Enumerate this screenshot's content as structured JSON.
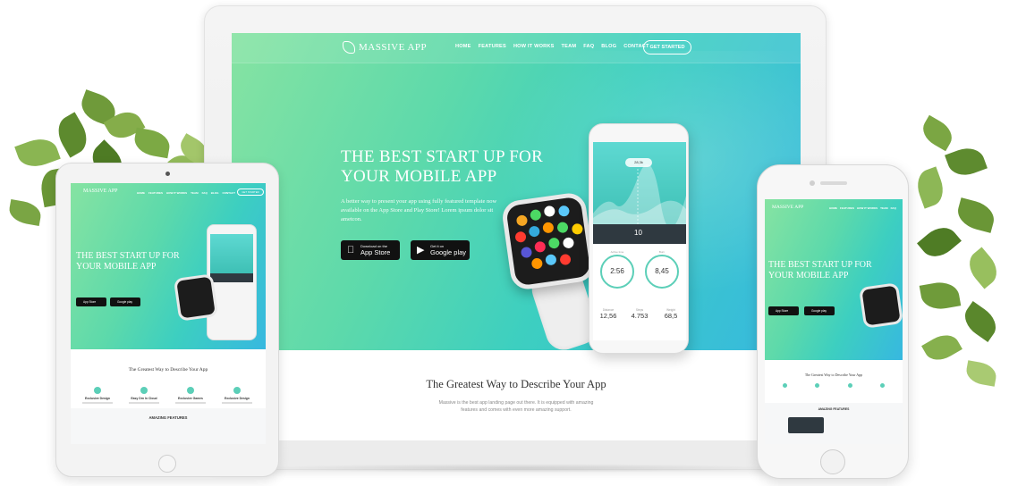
{
  "brand": {
    "name": "MASSIVE",
    "suffix": "APP"
  },
  "nav": {
    "links": [
      "HOME",
      "FEATURES",
      "HOW IT WORKS",
      "TEAM",
      "FAQ",
      "BLOG",
      "CONTACT"
    ],
    "cta": "GET STARTED"
  },
  "hero": {
    "title_line1": "THE BEST START UP FOR",
    "title_line2": "YOUR MOBILE APP",
    "text": "A better way to present your app using fully featured template now available on the App Store and Play Store! Lorem ipsum dolor sit ametcon.",
    "app_store": {
      "small": "Download on the",
      "big": "App Store"
    },
    "google_play": {
      "small": "Get it on",
      "big": "Google play"
    }
  },
  "section": {
    "title": "The Greatest Way to Describe Your App",
    "text": "Massive is the best app landing page out there. It is equipped with amazing features and comes with even more amazing support."
  },
  "tablet": {
    "section_title": "The Greatest Way to Describe Your App",
    "features": [
      "Exclusive Design",
      "Easy Drn In Cloud",
      "Exclusive Games",
      "Exclusive Design"
    ],
    "amazing": "AMAZING FEATURES"
  },
  "phone": {
    "nav_links": [
      "HOME",
      "FEATURES",
      "HOW IT WORKS",
      "TEAM",
      "FAQ"
    ],
    "section_title": "The Greatest Way to Describe Your App",
    "amazing": "AMAZING FEATURES"
  },
  "app_ui": {
    "badge": "28,3k",
    "active_time": {
      "label": "Active time",
      "value": "2:56"
    },
    "burn": {
      "label": "Burn",
      "value": "8,45"
    },
    "distance": {
      "label": "Distance",
      "value": "12,56"
    },
    "steps": {
      "label": "Steps",
      "value": "4.753"
    },
    "weight": {
      "label": "Weight",
      "value": "68,5"
    },
    "selected_day": "10"
  },
  "colors": {
    "hero_start": "#86e3a2",
    "hero_end": "#37b8e0",
    "accent": "#3ec0b5"
  }
}
